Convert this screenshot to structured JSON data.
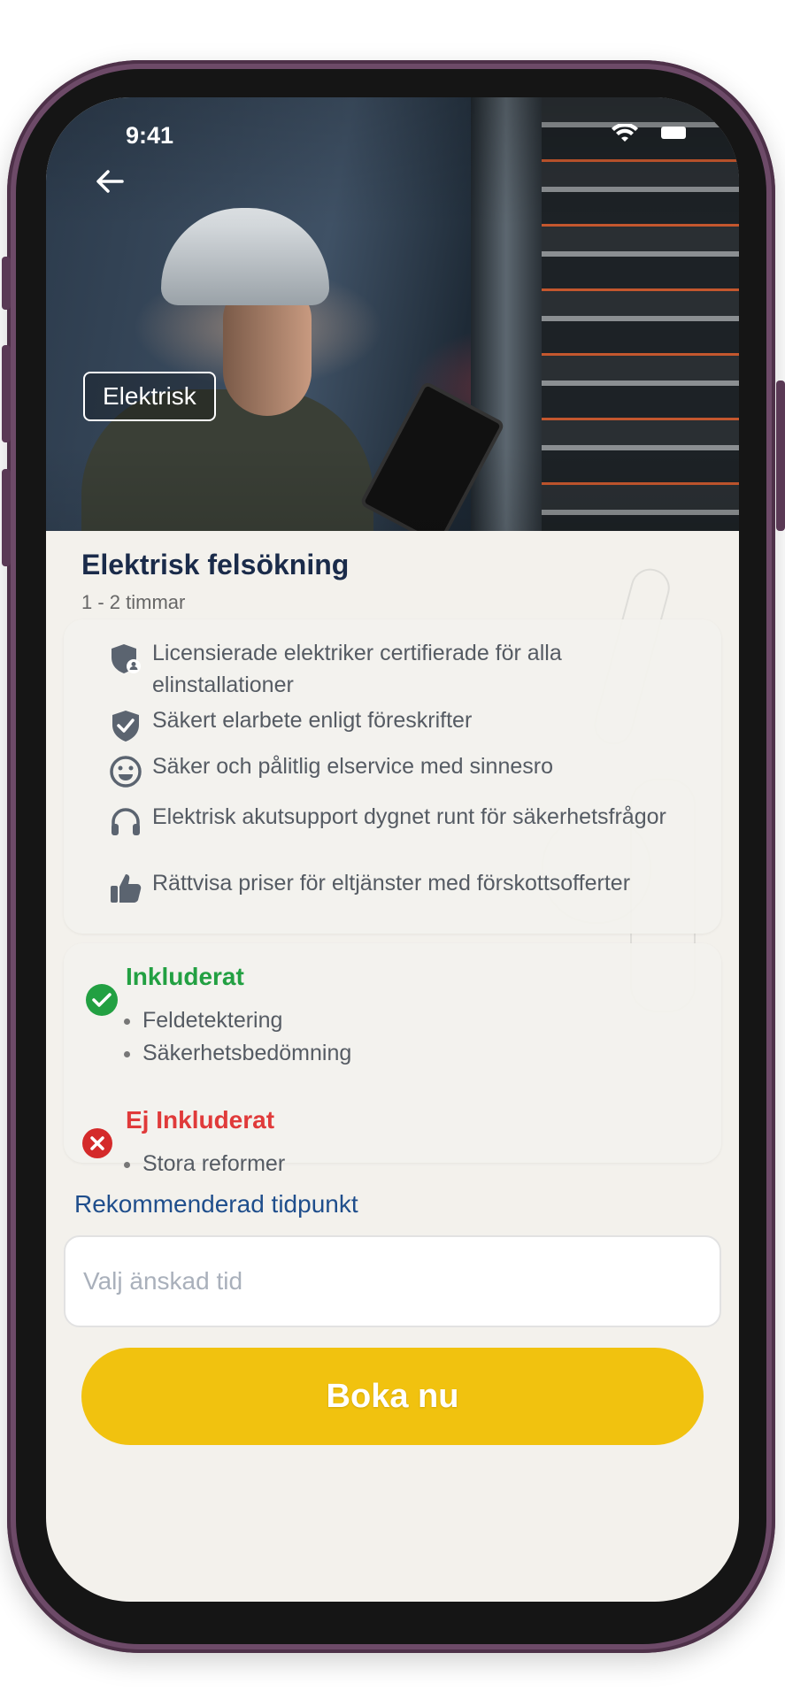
{
  "status_bar": {
    "time": "9:41"
  },
  "hero": {
    "category_tag": "Elektrisk"
  },
  "service": {
    "title": "Elektrisk felsökning",
    "duration": "1 - 2 timmar"
  },
  "features": [
    {
      "icon": "shield-user-icon",
      "text": "Licensierade elektriker certifierade för alla elinstallationer"
    },
    {
      "icon": "shield-check-icon",
      "text": "Säkert elarbete enligt föreskrifter"
    },
    {
      "icon": "smiley-icon",
      "text": "Säker och pålitlig elservice med sinnesro"
    },
    {
      "icon": "headphones-icon",
      "text": "Elektrisk akutsupport dygnet runt för säkerhetsfrågor"
    },
    {
      "icon": "thumbs-up-icon",
      "text": "Rättvisa priser för eltjänster med förskottsofferter"
    }
  ],
  "included": {
    "heading": "Inkluderat",
    "items": [
      "Feldetektering",
      "Säkerhetsbedömning"
    ]
  },
  "not_included": {
    "heading": "Ej Inkluderat",
    "items": [
      "Stora reformer"
    ]
  },
  "booking": {
    "recommended_label": "Rekommenderad tidpunkt",
    "time_placeholder": "Valj änskad tid",
    "time_value": "",
    "book_button": "Boka nu"
  },
  "colors": {
    "phone_frame": "#6d4a68",
    "title": "#1a2b4a",
    "included": "#22a042",
    "not_included": "#e03a3a",
    "link_blue": "#1f4e8c",
    "button": "#f1c20f"
  }
}
